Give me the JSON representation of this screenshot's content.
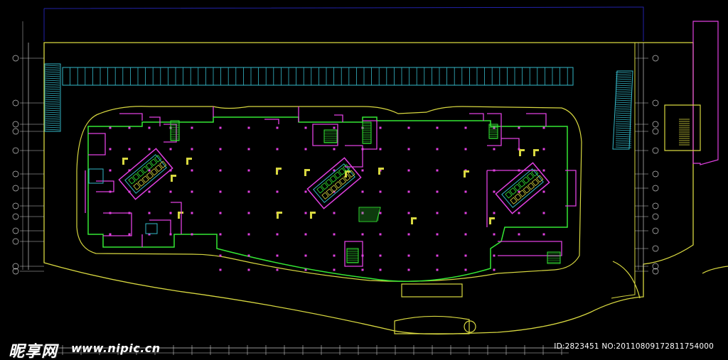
{
  "drawing": {
    "colors": {
      "background": "#000000",
      "boundary": "#d8d840",
      "perimeter": "#34e834",
      "walls": "#e040e0",
      "columns": "#e040e0",
      "structure": "#d8d840",
      "parking": "#35b8c8",
      "property_line": "#2222aa",
      "axis": "#c8c8c8"
    },
    "axis_labels_left": [
      "①",
      "②",
      "③",
      "④",
      "⑤",
      "⑥",
      "⑦",
      "⑧",
      "⑨",
      "⑩",
      "⑪",
      "⑫",
      "⑬"
    ],
    "axis_labels_right": [
      "①",
      "②",
      "③",
      "④",
      "⑤",
      "⑥",
      "⑦",
      "⑧",
      "⑨",
      "⑩",
      "⑪",
      "⑫",
      "⑬"
    ]
  },
  "watermark": {
    "logo": "昵享网",
    "site": "www.nipic.cn",
    "id_text": "ID:2823451 NO:20110809172811754000"
  }
}
